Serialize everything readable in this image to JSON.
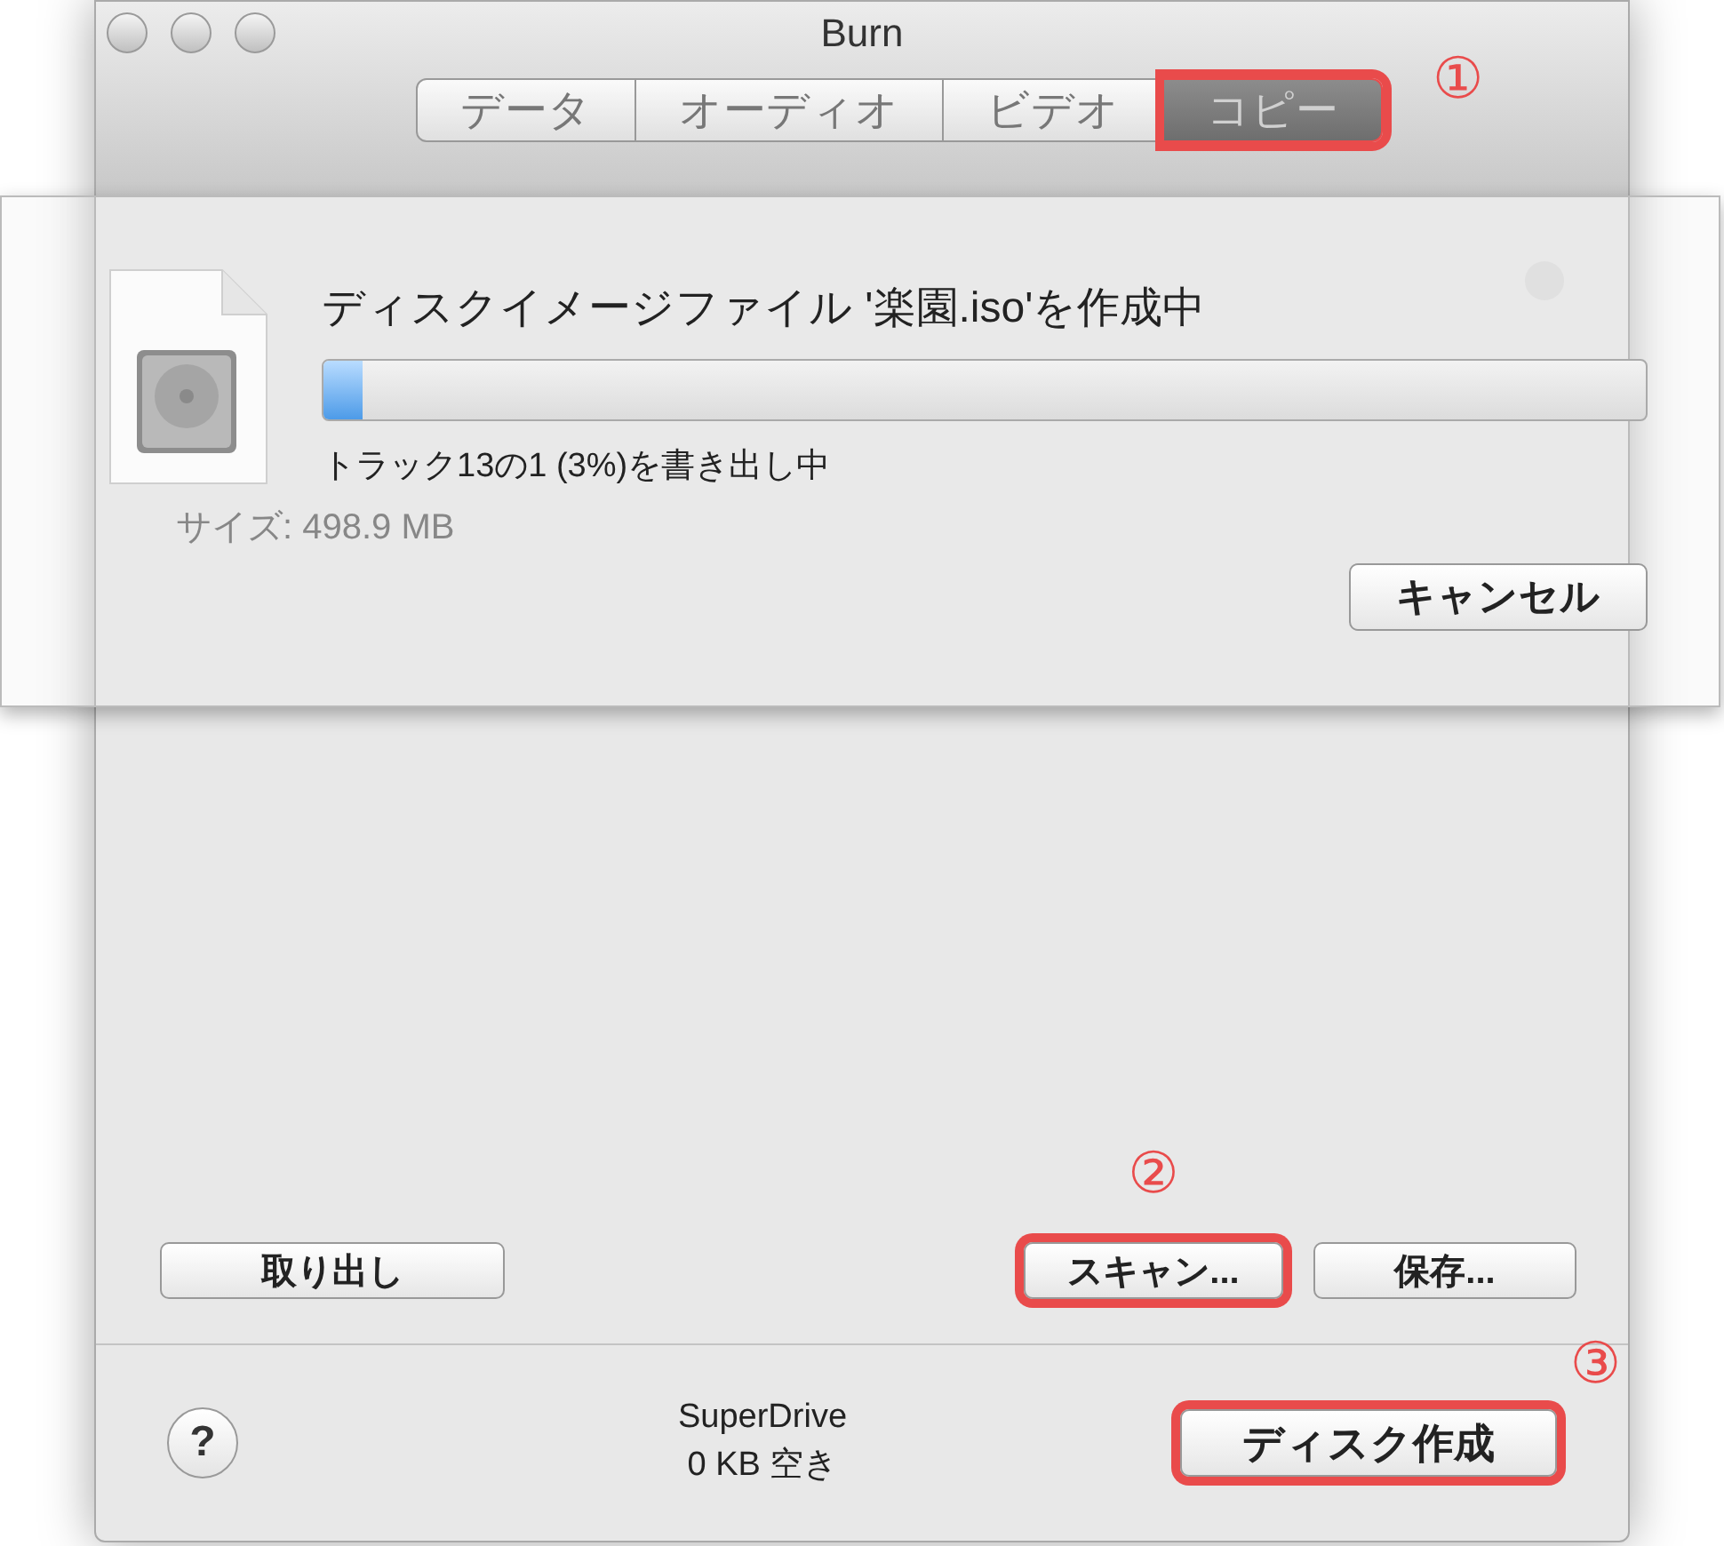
{
  "window": {
    "title": "Burn"
  },
  "tabs": [
    {
      "label": "データ",
      "selected": false,
      "highlighted": false
    },
    {
      "label": "オーディオ",
      "selected": false,
      "highlighted": false
    },
    {
      "label": "ビデオ",
      "selected": false,
      "highlighted": false
    },
    {
      "label": "コピー",
      "selected": true,
      "highlighted": true,
      "callout": "①"
    }
  ],
  "progress_sheet": {
    "title": "ディスクイメージファイル '楽園.iso'を作成中",
    "level": 0.03,
    "status": "トラック13の1 (3%)を書き出し中",
    "cancel_button": "キャンセル"
  },
  "background_text": "サイズ: 498.9 MB",
  "buttons": [
    {
      "label": "取り出し",
      "highlighted": false
    },
    {
      "label": "スキャン...",
      "highlighted": true,
      "callout": "②"
    },
    {
      "label": "保存...",
      "highlighted": false
    }
  ],
  "footer": {
    "help": "?",
    "drive_name": "SuperDrive",
    "free_space": "0 KB 空き",
    "burn_button": {
      "label": "ディスク作成",
      "highlighted": true,
      "callout": "③"
    }
  }
}
